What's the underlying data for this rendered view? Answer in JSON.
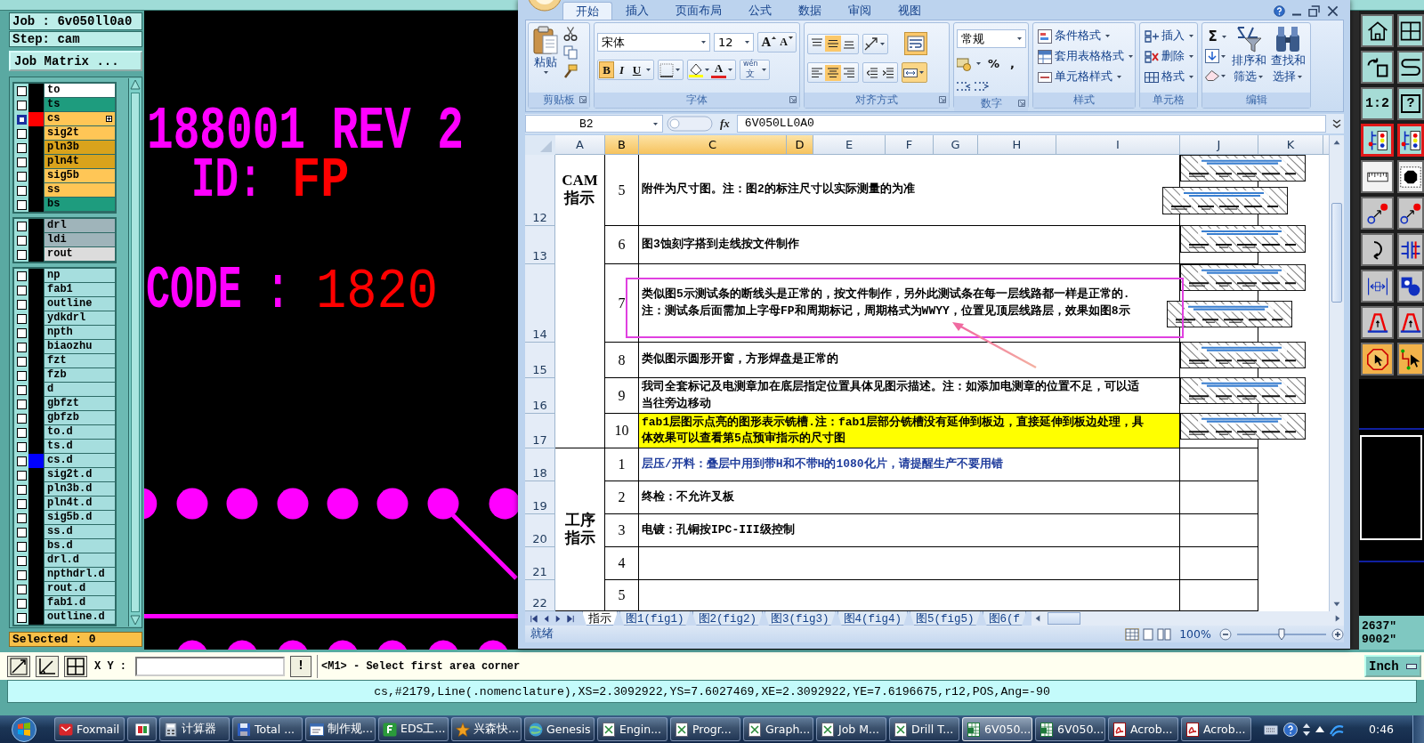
{
  "genesis": {
    "job": "Job : 6v050ll0a0",
    "step": "Step: cam",
    "matrix_button": "Job Matrix ...",
    "layer_groups": [
      {
        "layers": [
          {
            "name": "to",
            "color": "#ffffff",
            "selected": false
          },
          {
            "name": "ts",
            "color": "#1e9c7e",
            "selected": false
          },
          {
            "name": "cs",
            "color": "#ffc656",
            "selected": true,
            "swatch": {
              "color": "#ff0000"
            }
          },
          {
            "name": "sig2t",
            "color": "#ffc656",
            "selected": false
          },
          {
            "name": "pln3b",
            "color": "#d9a31c",
            "selected": false
          },
          {
            "name": "pln4t",
            "color": "#d9a31c",
            "selected": false
          },
          {
            "name": "sig5b",
            "color": "#ffc656",
            "selected": false
          },
          {
            "name": "ss",
            "color": "#ffc656",
            "selected": false
          },
          {
            "name": "bs",
            "color": "#1e9c7e",
            "selected": false
          }
        ]
      },
      {
        "layers": [
          {
            "name": "drl",
            "color": "#9fb4ba",
            "selected": false
          },
          {
            "name": "ldi",
            "color": "#9fb4ba",
            "selected": false
          },
          {
            "name": "rout",
            "color": "#dcdcdc",
            "selected": false
          }
        ]
      },
      {
        "layers": [
          {
            "name": "np",
            "color": "#a6dede",
            "selected": false
          },
          {
            "name": "fab1",
            "color": "#a6dede",
            "selected": false
          },
          {
            "name": "outline",
            "color": "#a6dede",
            "selected": false
          },
          {
            "name": "ydkdrl",
            "color": "#a6dede",
            "selected": false
          },
          {
            "name": "npth",
            "color": "#a6dede",
            "selected": false
          },
          {
            "name": "biaozhu",
            "color": "#a6dede",
            "selected": false
          },
          {
            "name": "fzt",
            "color": "#a6dede",
            "selected": false
          },
          {
            "name": "fzb",
            "color": "#a6dede",
            "selected": false
          },
          {
            "name": "d",
            "color": "#a6dede",
            "selected": false
          },
          {
            "name": "gbfzt",
            "color": "#a6dede",
            "selected": false
          },
          {
            "name": "gbfzb",
            "color": "#a6dede",
            "selected": false
          },
          {
            "name": "to.d",
            "color": "#a6dede",
            "selected": false
          },
          {
            "name": "ts.d",
            "color": "#a6dede",
            "selected": false
          },
          {
            "name": "cs.d",
            "color": "#a6dede",
            "selected": false,
            "swatch": {
              "color": "#0000ff"
            }
          },
          {
            "name": "sig2t.d",
            "color": "#a6dede",
            "selected": false
          },
          {
            "name": "pln3b.d",
            "color": "#a6dede",
            "selected": false
          },
          {
            "name": "pln4t.d",
            "color": "#a6dede",
            "selected": false
          },
          {
            "name": "sig5b.d",
            "color": "#a6dede",
            "selected": false
          },
          {
            "name": "ss.d",
            "color": "#a6dede",
            "selected": false
          },
          {
            "name": "bs.d",
            "color": "#a6dede",
            "selected": false
          },
          {
            "name": "drl.d",
            "color": "#a6dede",
            "selected": false
          },
          {
            "name": "npthdrl.d",
            "color": "#a6dede",
            "selected": false
          },
          {
            "name": "rout.d",
            "color": "#a6dede",
            "selected": false
          },
          {
            "name": "fab1.d",
            "color": "#a6dede",
            "selected": false
          },
          {
            "name": "outline.d",
            "color": "#a6dede",
            "selected": false
          }
        ]
      }
    ],
    "selected_count": "Selected : 0",
    "canvas_texts": [
      {
        "text": "188001 REV 2",
        "color": "#ff00ff"
      },
      {
        "text": "ID:",
        "color": "#ff00ff"
      },
      {
        "text": "FP",
        "color": "#ff0000"
      },
      {
        "text": "CODE :",
        "color": "#ff00ff"
      },
      {
        "text": "1820",
        "color": "#ff0000"
      }
    ],
    "tools": [
      {
        "kind": "home",
        "on": false
      },
      {
        "kind": "window",
        "on": false
      },
      {
        "kind": "undo",
        "on": false
      },
      {
        "kind": "snap",
        "on": false
      },
      {
        "kind": "scale",
        "label": "1:2",
        "on": false
      },
      {
        "kind": "help",
        "label": "?",
        "on": false
      },
      {
        "kind": "layers",
        "on": true
      },
      {
        "kind": "layers",
        "on": true
      },
      {
        "kind": "ruler",
        "on": false
      },
      {
        "kind": "pad",
        "on": false
      },
      {
        "kind": "connect",
        "on": false
      },
      {
        "kind": "connect",
        "on": false
      },
      {
        "kind": "rotate",
        "on": false
      },
      {
        "kind": "flip",
        "on": false
      },
      {
        "kind": "fit",
        "on": false
      },
      {
        "kind": "shapes",
        "on": false
      },
      {
        "kind": "arch",
        "on": false
      },
      {
        "kind": "arch",
        "on": false
      },
      {
        "kind": "select",
        "on": false
      },
      {
        "kind": "route",
        "on": false
      }
    ],
    "coordinates": [
      "2637\"",
      "9002\""
    ],
    "xy_label": "X Y :",
    "alert_button": "!",
    "message": "<M1> - Select first area corner",
    "units": "Inch",
    "feature_info": "cs,#2179,Line(.nomenclature),XS=2.3092922,YS=7.6027469,XE=2.3092922,YE=7.6196675,r12,POS,Ang=-90"
  },
  "excel": {
    "tabs": [
      {
        "label": "开始",
        "selected": true
      },
      {
        "label": "插入",
        "selected": false
      },
      {
        "label": "页面布局",
        "selected": false
      },
      {
        "label": "公式",
        "selected": false
      },
      {
        "label": "数据",
        "selected": false
      },
      {
        "label": "审阅",
        "selected": false
      },
      {
        "label": "视图",
        "selected": false
      }
    ],
    "ribbon": {
      "clipboard": {
        "label": "剪贴板",
        "paste": "粘贴"
      },
      "font": {
        "label": "字体",
        "family": "宋体",
        "size": "12",
        "grow": "A",
        "shrink": "A",
        "styles": [
          {
            "text": "B",
            "kind": "bold",
            "on": true
          },
          {
            "text": "I",
            "kind": "italic",
            "on": false
          },
          {
            "text": "U",
            "kind": "underline",
            "on": false
          }
        ],
        "font_color": "A",
        "phonetic": [
          "wén",
          "文"
        ]
      },
      "alignment": {
        "label": "对齐方式",
        "vertical": [
          {
            "kind": "top",
            "on": false
          },
          {
            "kind": "middle",
            "on": true
          },
          {
            "kind": "bottom",
            "on": false
          }
        ],
        "horizontal": [
          {
            "kind": "left",
            "on": false
          },
          {
            "kind": "center",
            "on": true
          },
          {
            "kind": "right",
            "on": false
          }
        ],
        "wrap_text": {
          "on": true
        },
        "merge": {
          "on": true
        }
      },
      "number": {
        "label": "数字",
        "format": "常规",
        "symbols": [
          "%",
          ","
        ]
      },
      "styles": {
        "label": "样式",
        "commands": [
          {
            "kind": "conditional",
            "label": "条件格式"
          },
          {
            "kind": "table",
            "label": "套用表格格式"
          },
          {
            "kind": "cell-style",
            "label": "单元格样式"
          }
        ]
      },
      "cells": {
        "label": "单元格",
        "commands": [
          {
            "kind": "insert",
            "label": "插入"
          },
          {
            "kind": "delete",
            "label": "删除"
          },
          {
            "kind": "format",
            "label": "格式"
          }
        ]
      },
      "editing": {
        "label": "编辑",
        "sum": "Σ",
        "sort": [
          "排序和",
          "筛选"
        ],
        "find": [
          "查找和",
          "选择"
        ]
      }
    },
    "name_box": "B2",
    "function_button": "fx",
    "formula": "6V050LL0A0",
    "columns": [
      {
        "label": "A",
        "selected": false
      },
      {
        "label": "B",
        "selected": true
      },
      {
        "label": "C",
        "selected": true
      },
      {
        "label": "D",
        "selected": true
      },
      {
        "label": "E",
        "selected": false
      },
      {
        "label": "F",
        "selected": false
      },
      {
        "label": "G",
        "selected": false
      },
      {
        "label": "H",
        "selected": false
      },
      {
        "label": "I",
        "selected": false
      },
      {
        "label": "J",
        "selected": false
      },
      {
        "label": "K",
        "selected": false
      }
    ],
    "sections": [
      {
        "label": "CAM\n指示",
        "rows": [
          {
            "header": "12",
            "number": "5",
            "text": "附件为尺寸图。注：图2的标注尺寸以实际测量的为准",
            "highlight": false
          },
          {
            "header": "13",
            "number": "6",
            "text": "图3蚀刻字搭到走线按文件制作",
            "highlight": false
          },
          {
            "header": "14",
            "number": "7",
            "text": "类似图5示测试条的断线头是正常的，按文件制作，另外此测试条在每一层线路都一样是正常的.\n注：测试条后面需加上字母FP和周期标记，周期格式为WWYY，位置见顶层线路层，效果如图8示",
            "highlight": false
          },
          {
            "header": "15",
            "number": "8",
            "text": "类似图示圆形开窗，方形焊盘是正常的",
            "highlight": false
          },
          {
            "header": "16",
            "number": "9",
            "text": "我司全套标记及电测章加在底层指定位置具体见图示描述。注：如添加电测章的位置不足，可以适当往旁边移动",
            "highlight": false
          },
          {
            "header": "17",
            "number": "10",
            "text": "fab1层图示点亮的图形表示铣槽.注：fab1层部分铣槽没有延伸到板边，直接延伸到板边处理，具体效果可以查看第5点预审指示的尺寸图",
            "highlight": true
          }
        ]
      },
      {
        "label": "工序指示",
        "rows": [
          {
            "header": "18",
            "number": "1",
            "text": "层压/开料：叠层中用到带H和不带H的1080化片，请提醒生产不要用错",
            "color": "#1f3c9c",
            "highlight": false
          },
          {
            "header": "19",
            "number": "2",
            "text": "终检：不允许叉板",
            "highlight": false
          },
          {
            "header": "20",
            "number": "3",
            "text": "电镀：孔铜按IPC-III级控制",
            "highlight": false
          },
          {
            "header": "21",
            "number": "4",
            "highlight": false
          },
          {
            "header": "22",
            "number": "5",
            "highlight": false
          }
        ]
      }
    ],
    "sheet_tabs": [
      {
        "label": "指示",
        "selected": true
      },
      {
        "label": "图1(fig1)",
        "selected": false
      },
      {
        "label": "图2(fig2)",
        "selected": false
      },
      {
        "label": "图3(fig3)",
        "selected": false
      },
      {
        "label": "图4(fig4)",
        "selected": false
      },
      {
        "label": "图5(fig5)",
        "selected": false
      },
      {
        "label": "图6(f",
        "selected": false
      }
    ],
    "status": "就绪",
    "zoom": {
      "label": "100%",
      "level": 0.5
    }
  },
  "taskbar": {
    "buttons": [
      {
        "label": "Foxmail",
        "kind": "mail",
        "active": false
      },
      {
        "kind": "image",
        "active": false
      },
      {
        "label": "计算器",
        "kind": "calculator",
        "active": false
      },
      {
        "label": "Total ...",
        "kind": "disk",
        "active": false
      },
      {
        "label": "制作规...",
        "kind": "window",
        "active": false
      },
      {
        "label": "EDS工...",
        "kind": "tile",
        "active": false
      },
      {
        "label": "兴森快...",
        "kind": "star",
        "active": false
      },
      {
        "label": "Genesis",
        "kind": "globe",
        "active": false
      },
      {
        "label": "Engin...",
        "kind": "document",
        "active": false
      },
      {
        "label": "Progr...",
        "kind": "document",
        "active": false
      },
      {
        "label": "Graph...",
        "kind": "document",
        "active": false
      },
      {
        "label": "Job M...",
        "kind": "document",
        "active": false
      },
      {
        "label": "Drill T...",
        "kind": "document",
        "active": false
      },
      {
        "label": "6V050...",
        "kind": "spreadsheet",
        "active": true
      },
      {
        "label": "6V050...",
        "kind": "spreadsheet",
        "active": false
      },
      {
        "label": "Acrob...",
        "kind": "pdf",
        "active": false
      },
      {
        "label": "Acrob...",
        "kind": "pdf",
        "active": false
      }
    ],
    "clock": "0:46"
  }
}
